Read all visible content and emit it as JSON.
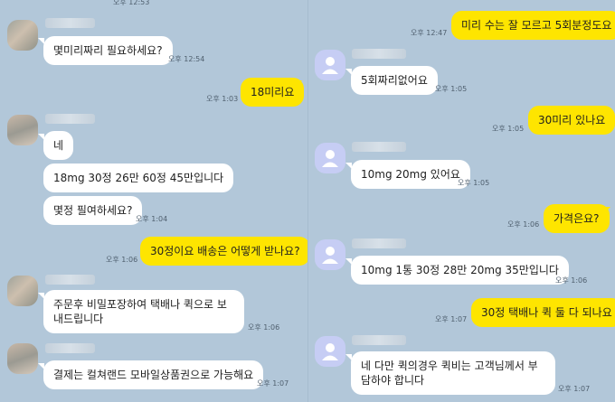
{
  "left": {
    "messages": [
      {
        "time": "오후 12:53"
      },
      {
        "text": "몇미리짜리 필요하세요?",
        "time": "오후 12:54"
      },
      {
        "text": "18미리요",
        "time": "오후 1:03"
      },
      {
        "text": "네"
      },
      {
        "text": "18mg 30정 26만 60정 45만입니다"
      },
      {
        "text": "몇정 필여하세요?",
        "time": "오후 1:04"
      },
      {
        "text": "30정이요 배송은 어떻게 받나요?",
        "time": "오후 1:06"
      },
      {
        "text": "주문후 비밀포장하여 택배나 퀵으로 보내드립니다",
        "time": "오후 1:06"
      },
      {
        "text": "결제는 컬쳐랜드 모바일상품권으로 가능해요",
        "time": "오후 1:07"
      }
    ]
  },
  "right": {
    "messages": [
      {
        "text": "미리 수는 잘 모르고 5회분정도요",
        "time": "오후 12:47"
      },
      {
        "text": "5회짜리없어요",
        "time": "오후 1:05"
      },
      {
        "text": "30미리 있나요",
        "time": "오후 1:05"
      },
      {
        "text": "10mg 20mg 있어요",
        "time": "오후 1:05"
      },
      {
        "text": "가격은요?",
        "time": "오후 1:06"
      },
      {
        "text": "10mg 1통 30정 28만 20mg 35만입니다",
        "time": "오후 1:06"
      },
      {
        "text": "30정 택배나 퀵 둘 다 되나요",
        "time": "오후 1:07"
      },
      {
        "text": "네 다만 퀵의경우 퀵비는 고객님께서 부담하야 합니다",
        "time": "오후 1:07"
      }
    ]
  },
  "colors": {
    "background": "#b2c7d9",
    "my_bubble": "#fee500",
    "their_bubble": "#ffffff"
  }
}
